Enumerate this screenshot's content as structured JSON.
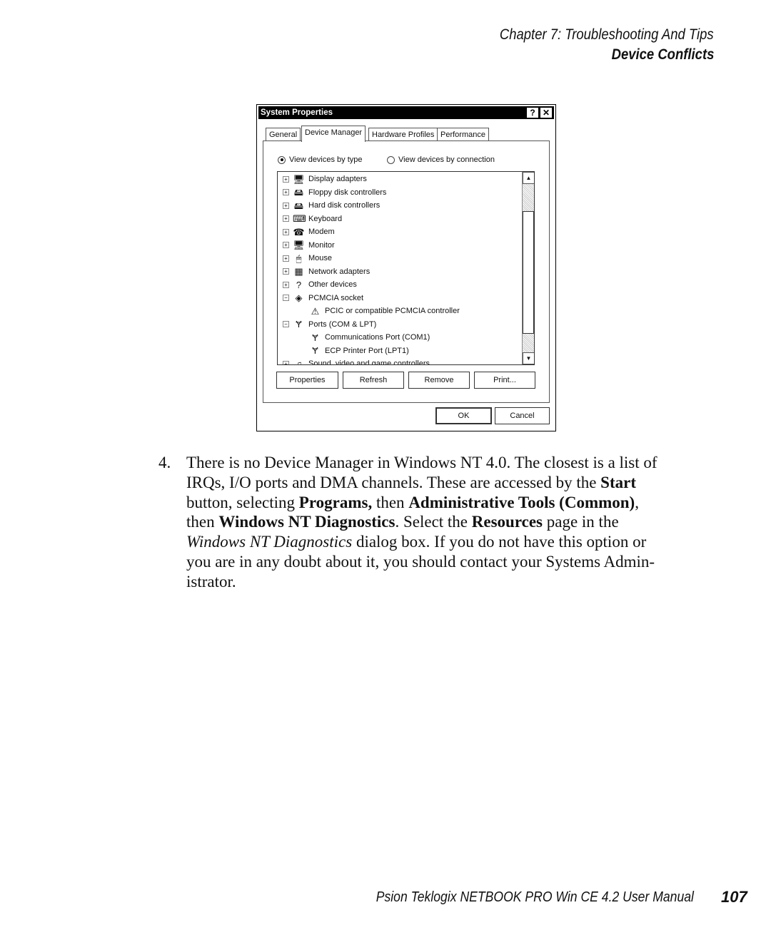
{
  "header": {
    "chapter": "Chapter 7:  Troubleshooting And Tips",
    "section": "Device Conflicts"
  },
  "dialog": {
    "title": "System Properties",
    "help": "?",
    "close": "✕",
    "tabs": [
      "General",
      "Device Manager",
      "Hardware Profiles",
      "Performance"
    ],
    "selected_tab": "Device Manager",
    "radio_type": "View devices by type",
    "radio_connection": "View devices by connection",
    "selected_radio": "type",
    "tree": [
      {
        "label": "Display adapters",
        "icon": "monitor-icon",
        "level": 0,
        "toggle": "+"
      },
      {
        "label": "Floppy disk controllers",
        "icon": "disk-controller-icon",
        "level": 0,
        "toggle": "+"
      },
      {
        "label": "Hard disk controllers",
        "icon": "disk-controller-icon",
        "level": 0,
        "toggle": "+"
      },
      {
        "label": "Keyboard",
        "icon": "keyboard-icon",
        "level": 0,
        "toggle": "+"
      },
      {
        "label": "Modem",
        "icon": "modem-icon",
        "level": 0,
        "toggle": "+"
      },
      {
        "label": "Monitor",
        "icon": "monitor-icon",
        "level": 0,
        "toggle": "+"
      },
      {
        "label": "Mouse",
        "icon": "mouse-icon",
        "level": 0,
        "toggle": "+"
      },
      {
        "label": "Network adapters",
        "icon": "network-adapter-icon",
        "level": 0,
        "toggle": "+"
      },
      {
        "label": "Other devices",
        "icon": "question-icon",
        "level": 0,
        "toggle": "+"
      },
      {
        "label": "PCMCIA socket",
        "icon": "pcmcia-icon",
        "level": 0,
        "toggle": "−"
      },
      {
        "label": "PCIC or compatible PCMCIA controller",
        "icon": "pcmcia-warning-icon",
        "level": 1,
        "toggle": ""
      },
      {
        "label": "Ports (COM & LPT)",
        "icon": "port-icon",
        "level": 0,
        "toggle": "−"
      },
      {
        "label": "Communications Port (COM1)",
        "icon": "port-icon",
        "level": 1,
        "toggle": ""
      },
      {
        "label": "ECP Printer Port (LPT1)",
        "icon": "port-icon",
        "level": 1,
        "toggle": ""
      },
      {
        "label": "Sound, video and game controllers",
        "icon": "sound-icon",
        "level": 0,
        "toggle": "+"
      }
    ],
    "buttons": {
      "properties": "Properties",
      "refresh": "Refresh",
      "remove": "Remove",
      "print": "Print...",
      "ok": "OK",
      "cancel": "Cancel"
    }
  },
  "body": {
    "number": "4.",
    "t1": "There is no Device Manager in Windows NT 4.0. The closest is a list of",
    "t2": "IRQs, I/O ports and DMA channels. These are accessed by the ",
    "b_start": "Start",
    "t3": "button, selecting ",
    "b_programs": "Programs,",
    "t4": " then ",
    "b_admin": "Administrative Tools (Common)",
    "t5": ",",
    "t6": "then ",
    "b_diag": "Windows NT Diagnostics",
    "t7": ". Select the ",
    "b_res": "Resources",
    "t8": " page in the",
    "i_dlg": "Windows NT Diagnostics",
    "t9": " dialog box. If you do not have this option or",
    "t10": "you are in any doubt about it, you should contact your Systems Admin-",
    "t11": "istrator."
  },
  "footer": {
    "manual": "Psion Teklogix NETBOOK PRO Win CE 4.2 User Manual",
    "page": "107"
  }
}
